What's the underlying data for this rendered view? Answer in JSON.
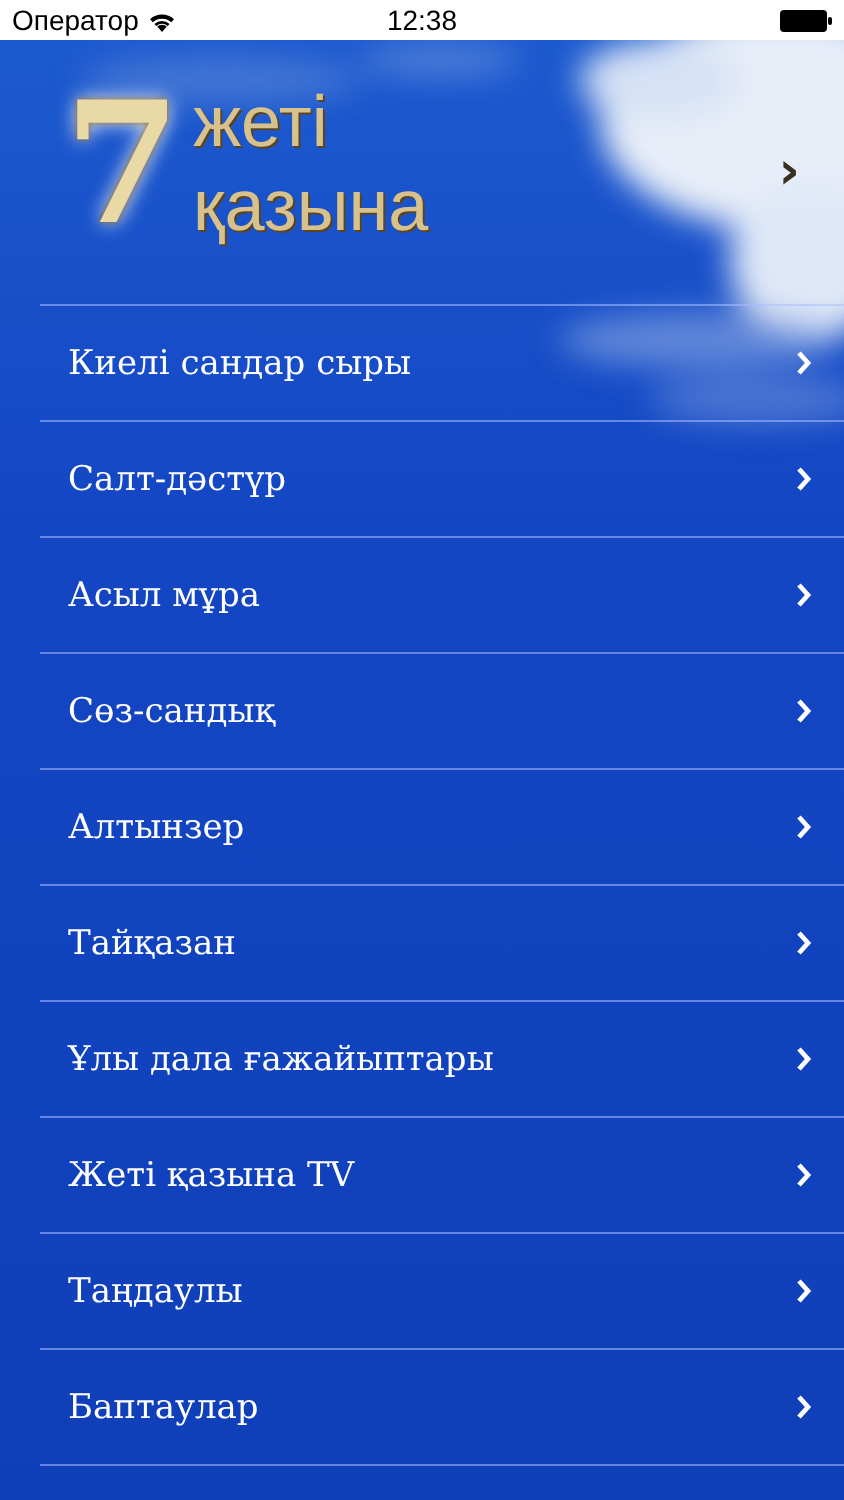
{
  "status_bar": {
    "carrier": "Оператор",
    "time": "12:38"
  },
  "header": {
    "logo_number": "7",
    "logo_line_1": "жеті",
    "logo_line_2": "қазына",
    "chevron": "›"
  },
  "menu": [
    {
      "label": "Киелі сандар сыры"
    },
    {
      "label": "Салт-дәстүр"
    },
    {
      "label": "Асыл мұра"
    },
    {
      "label": "Сөз-сандық"
    },
    {
      "label": "Алтынзер"
    },
    {
      "label": "Тайқазан"
    },
    {
      "label": "Ұлы дала ғажайыптары"
    },
    {
      "label": "Жеті қазына TV"
    },
    {
      "label": "Таңдаулы"
    },
    {
      "label": "Баптаулар"
    }
  ]
}
